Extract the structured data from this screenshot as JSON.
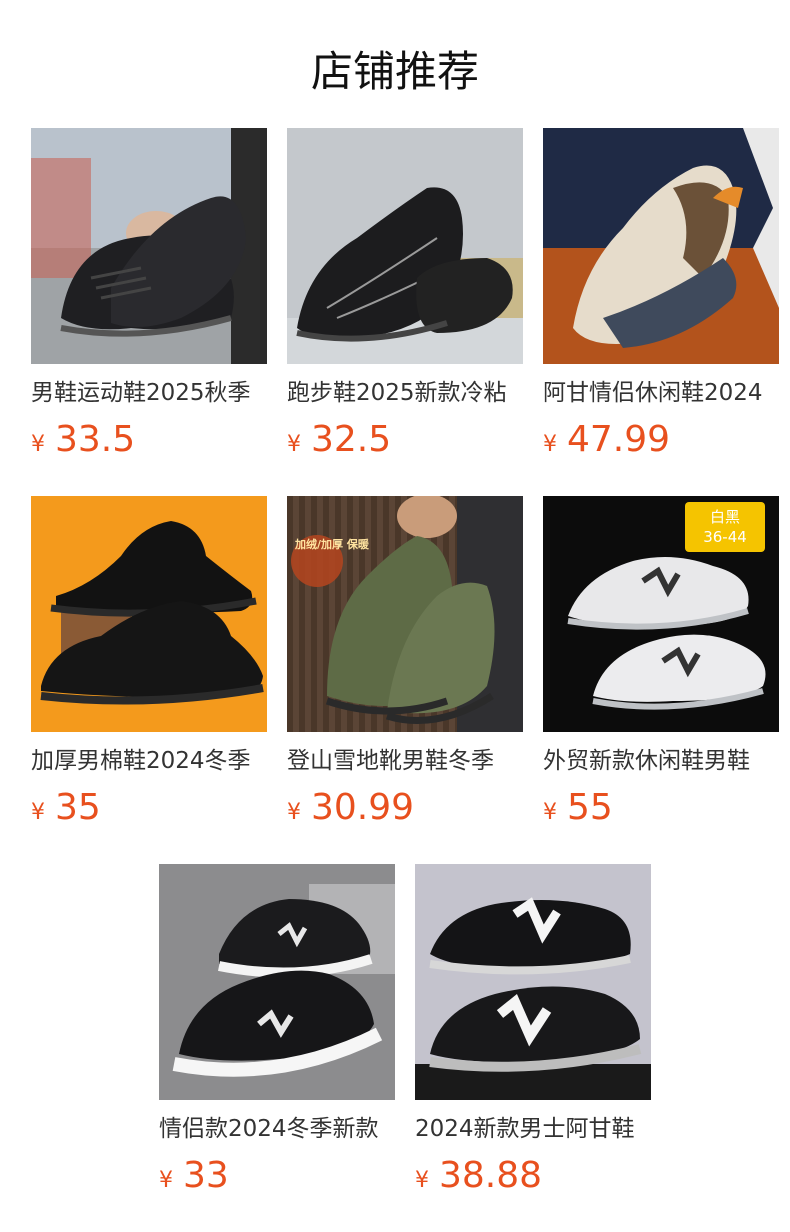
{
  "section_title": "店铺推荐",
  "currency_symbol": "¥",
  "products": [
    {
      "name": "男鞋运动鞋2025秋季",
      "price": "33.5",
      "image": "black-leather-sneaker-photo"
    },
    {
      "name": "跑步鞋2025新款冷粘",
      "price": "32.5",
      "image": "black-running-shoe-photo"
    },
    {
      "name": "阿甘情侣休闲鞋2024",
      "price": "47.99",
      "image": "beige-retro-sneaker-photo"
    },
    {
      "name": "加厚男棉鞋2024冬季",
      "price": "35",
      "image": "black-leather-boot-photo"
    },
    {
      "name": "登山雪地靴男鞋冬季",
      "price": "30.99",
      "image": "olive-hiking-boot-photo",
      "overlay_text": "加绒/加厚 保暖"
    },
    {
      "name": "外贸新款休闲鞋男鞋",
      "price": "55",
      "image": "white-silver-sneaker-photo",
      "badge": {
        "line1": "白黑",
        "line2": "36-44"
      }
    },
    {
      "name": "情侣款2024冬季新款",
      "price": "33",
      "image": "black-white-n-sneaker-photo"
    },
    {
      "name": "2024新款男士阿甘鞋",
      "price": "38.88",
      "image": "black-white-retro-n-sneaker-photo"
    }
  ]
}
